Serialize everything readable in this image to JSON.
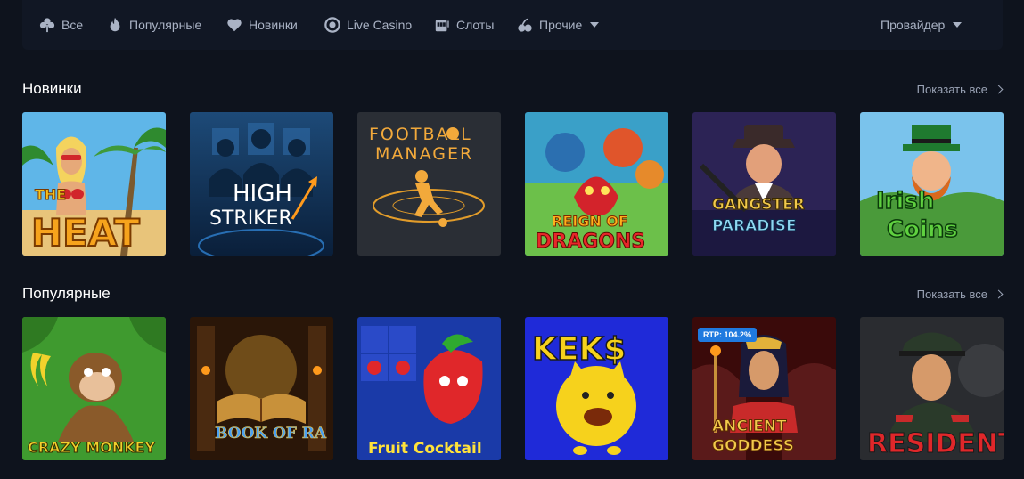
{
  "nav": {
    "items": [
      {
        "label": "Все",
        "icon": "clover-icon"
      },
      {
        "label": "Популярные",
        "icon": "flame-icon"
      },
      {
        "label": "Новинки",
        "icon": "heart-icon"
      },
      {
        "label": "Live Casino",
        "icon": "chip-icon"
      },
      {
        "label": "Слоты",
        "icon": "slot-machine-icon"
      },
      {
        "label": "Прочие",
        "icon": "cherries-icon"
      }
    ],
    "provider_label": "Провайдер"
  },
  "sections": [
    {
      "title": "Новинки",
      "show_all": "Показать все",
      "games": [
        {
          "title": "THE HEAT"
        },
        {
          "title": "HIGH STRIKER"
        },
        {
          "title": "FOOTBALL MANAGER"
        },
        {
          "title": "REIGN OF DRAGONS"
        },
        {
          "title": "GANGSTER PARADISE"
        },
        {
          "title": "Irish Coins"
        }
      ]
    },
    {
      "title": "Популярные",
      "show_all": "Показать все",
      "games": [
        {
          "title": "CRAZY MONKEY"
        },
        {
          "title": "BOOK OF RA"
        },
        {
          "title": "Fruit Cocktail"
        },
        {
          "title": "KEK$"
        },
        {
          "title": "ANCIENT GODDESS",
          "badge": "RTP: 104.2%"
        },
        {
          "title": "RESIDENT"
        }
      ]
    }
  ],
  "colors": {
    "background": "#0e131d",
    "nav_background": "#111724",
    "nav_text": "#aab3c5",
    "muted_text": "#9aa3b5",
    "badge": "#1f7adf"
  }
}
